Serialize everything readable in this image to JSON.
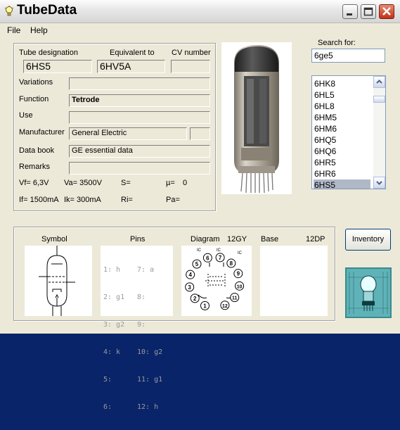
{
  "app": {
    "title": "TubeData"
  },
  "menu": {
    "file": "File",
    "help": "Help"
  },
  "labels": {
    "tube_designation": "Tube designation",
    "equivalent_to": "Equivalent to",
    "cv_number": "CV number",
    "variations": "Variations",
    "function": "Function",
    "use": "Use",
    "manufacturer": "Manufacturer",
    "data_book": "Data book",
    "remarks": "Remarks",
    "search_for": "Search for:",
    "symbol": "Symbol",
    "pins": "Pins",
    "diagram": "Diagram",
    "base": "Base"
  },
  "tube": {
    "designation": "6HS5",
    "equivalent": "6HV5A",
    "cv_number": "",
    "variations": "",
    "function": "Tetrode",
    "use": "",
    "manufacturer": "General Electric",
    "manufacturer_extra": "",
    "data_book": "GE essential data",
    "remarks": ""
  },
  "params": {
    "vf": "Vf= 6,3V",
    "va": "Va= 3500V",
    "s": "S=",
    "mu": "µ=",
    "mu_value": "0",
    "if": "If= 1500mA",
    "ik": "Ik= 300mA",
    "ri": "Ri=",
    "pa": "Pa="
  },
  "search": {
    "value": "6ge5"
  },
  "tube_list": [
    "6HK8",
    "6HL5",
    "6HL8",
    "6HM5",
    "6HM6",
    "6HQ5",
    "6HQ6",
    "6HR5",
    "6HR6",
    "6HS5"
  ],
  "selected_tube": "6HS5",
  "diagram": {
    "code": "12GY"
  },
  "base": {
    "code": "12DP"
  },
  "pins": {
    "left": [
      "1: h",
      "2: g1",
      "3: g2",
      "4: k",
      "5:",
      "6:"
    ],
    "right": [
      "7: a",
      "8:",
      "9:",
      "10: g2",
      "11: g1",
      "12: h"
    ]
  },
  "diagram_pins": [
    "1",
    "2",
    "3",
    "4",
    "5",
    "6",
    "7",
    "8",
    "9",
    "10",
    "11",
    "12"
  ],
  "diagram_ic": [
    "IC",
    "IC",
    "IC"
  ],
  "inventory_button": "Inventory",
  "colors": {
    "title_close": "#c2321a",
    "list_selected": "#b0b8c8",
    "window_bg": "#ece9d8"
  }
}
